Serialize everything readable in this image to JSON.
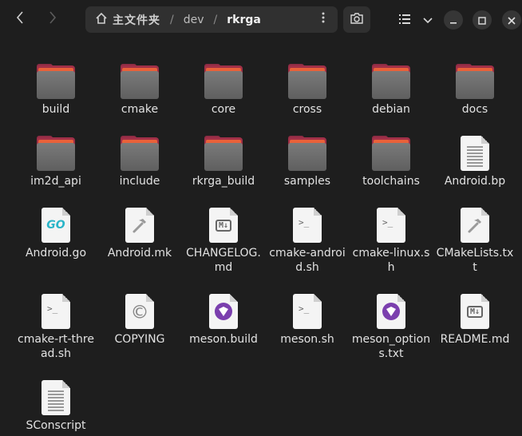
{
  "header": {
    "back_icon": "chevron-left-icon",
    "forward_icon": "chevron-right-icon",
    "path": {
      "home": "主文件夹",
      "middle": "dev",
      "current": "rkrga",
      "separator": "/"
    },
    "path_menu_icon": "vertical-ellipsis-icon",
    "search_icon": "search-icon",
    "view_icon": "list-view-icon",
    "view_dropdown_icon": "chevron-down-icon",
    "window_controls": [
      "minimize-icon",
      "maximize-icon",
      "close-icon"
    ]
  },
  "colors": {
    "background": "#1e1e1e",
    "folder_front": "#6f6f6f",
    "folder_back": "#a23048",
    "folder_stripe": "#e9613a",
    "meson_purple": "#7b3fae",
    "go_teal": "#2ab5c8"
  },
  "files": [
    {
      "name": "build",
      "icon": "folder-icon"
    },
    {
      "name": "cmake",
      "icon": "folder-icon"
    },
    {
      "name": "core",
      "icon": "folder-icon"
    },
    {
      "name": "cross",
      "icon": "folder-icon"
    },
    {
      "name": "debian",
      "icon": "folder-icon"
    },
    {
      "name": "docs",
      "icon": "folder-icon"
    },
    {
      "name": "im2d_api",
      "icon": "folder-icon"
    },
    {
      "name": "include",
      "icon": "folder-icon"
    },
    {
      "name": "rkrga_build",
      "icon": "folder-icon"
    },
    {
      "name": "samples",
      "icon": "folder-icon"
    },
    {
      "name": "toolchains",
      "icon": "folder-icon"
    },
    {
      "name": "Android.bp",
      "icon": "text-file-icon"
    },
    {
      "name": "Android.go",
      "icon": "go-file-icon",
      "glyph": "GO"
    },
    {
      "name": "Android.mk",
      "icon": "makefile-icon"
    },
    {
      "name": "CHANGELOG.md",
      "icon": "markdown-file-icon",
      "glyph": "M↓"
    },
    {
      "name": "cmake-android.sh",
      "icon": "shell-script-icon",
      "glyph": ">_"
    },
    {
      "name": "cmake-linux.sh",
      "icon": "shell-script-icon",
      "glyph": ">_"
    },
    {
      "name": "CMakeLists.txt",
      "icon": "makefile-icon"
    },
    {
      "name": "cmake-rt-thread.sh",
      "icon": "shell-script-icon",
      "glyph": ">_"
    },
    {
      "name": "COPYING",
      "icon": "copyright-file-icon",
      "glyph": "©"
    },
    {
      "name": "meson.build",
      "icon": "meson-file-icon"
    },
    {
      "name": "meson.sh",
      "icon": "shell-script-icon",
      "glyph": ">_"
    },
    {
      "name": "meson_options.txt",
      "icon": "meson-file-icon"
    },
    {
      "name": "README.md",
      "icon": "markdown-file-icon",
      "glyph": "M↓"
    },
    {
      "name": "SConscript",
      "icon": "text-file-icon"
    }
  ]
}
